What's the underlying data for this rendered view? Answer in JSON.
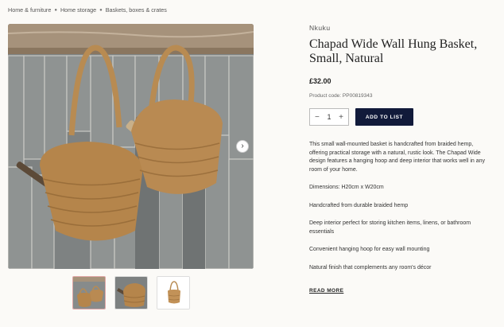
{
  "breadcrumb": [
    "Home & furniture",
    "Home storage",
    "Baskets, boxes & crates"
  ],
  "product": {
    "brand": "Nkuku",
    "title": "Chapad Wide Wall Hung Basket, Small, Natural",
    "price": "£32.00",
    "code": "Product code: PP00819343",
    "quantity": "1",
    "add_label": "ADD TO LIST",
    "description": "This small wall-mounted basket is handcrafted from braided hemp, offering practical storage with a natural, rustic look. The Chapad Wide design features a hanging hoop and deep interior that works well in any room of your home.",
    "features": [
      "Dimensions: H20cm x W20cm",
      "Handcrafted from durable braided hemp",
      "Deep interior perfect for storing kitchen items, linens, or bathroom essentials",
      "Convenient hanging hoop for easy wall mounting",
      "Natural finish that complements any room's décor"
    ],
    "read_more": "READ MORE"
  },
  "gallery": {
    "thumbnails": [
      "basket-pair-thumbnail",
      "basket-utensils-thumbnail",
      "basket-product-thumbnail"
    ],
    "active_index": 0
  },
  "colors": {
    "button": "#111a3a",
    "basket": "#b5854b",
    "tile": "#7f8383"
  }
}
